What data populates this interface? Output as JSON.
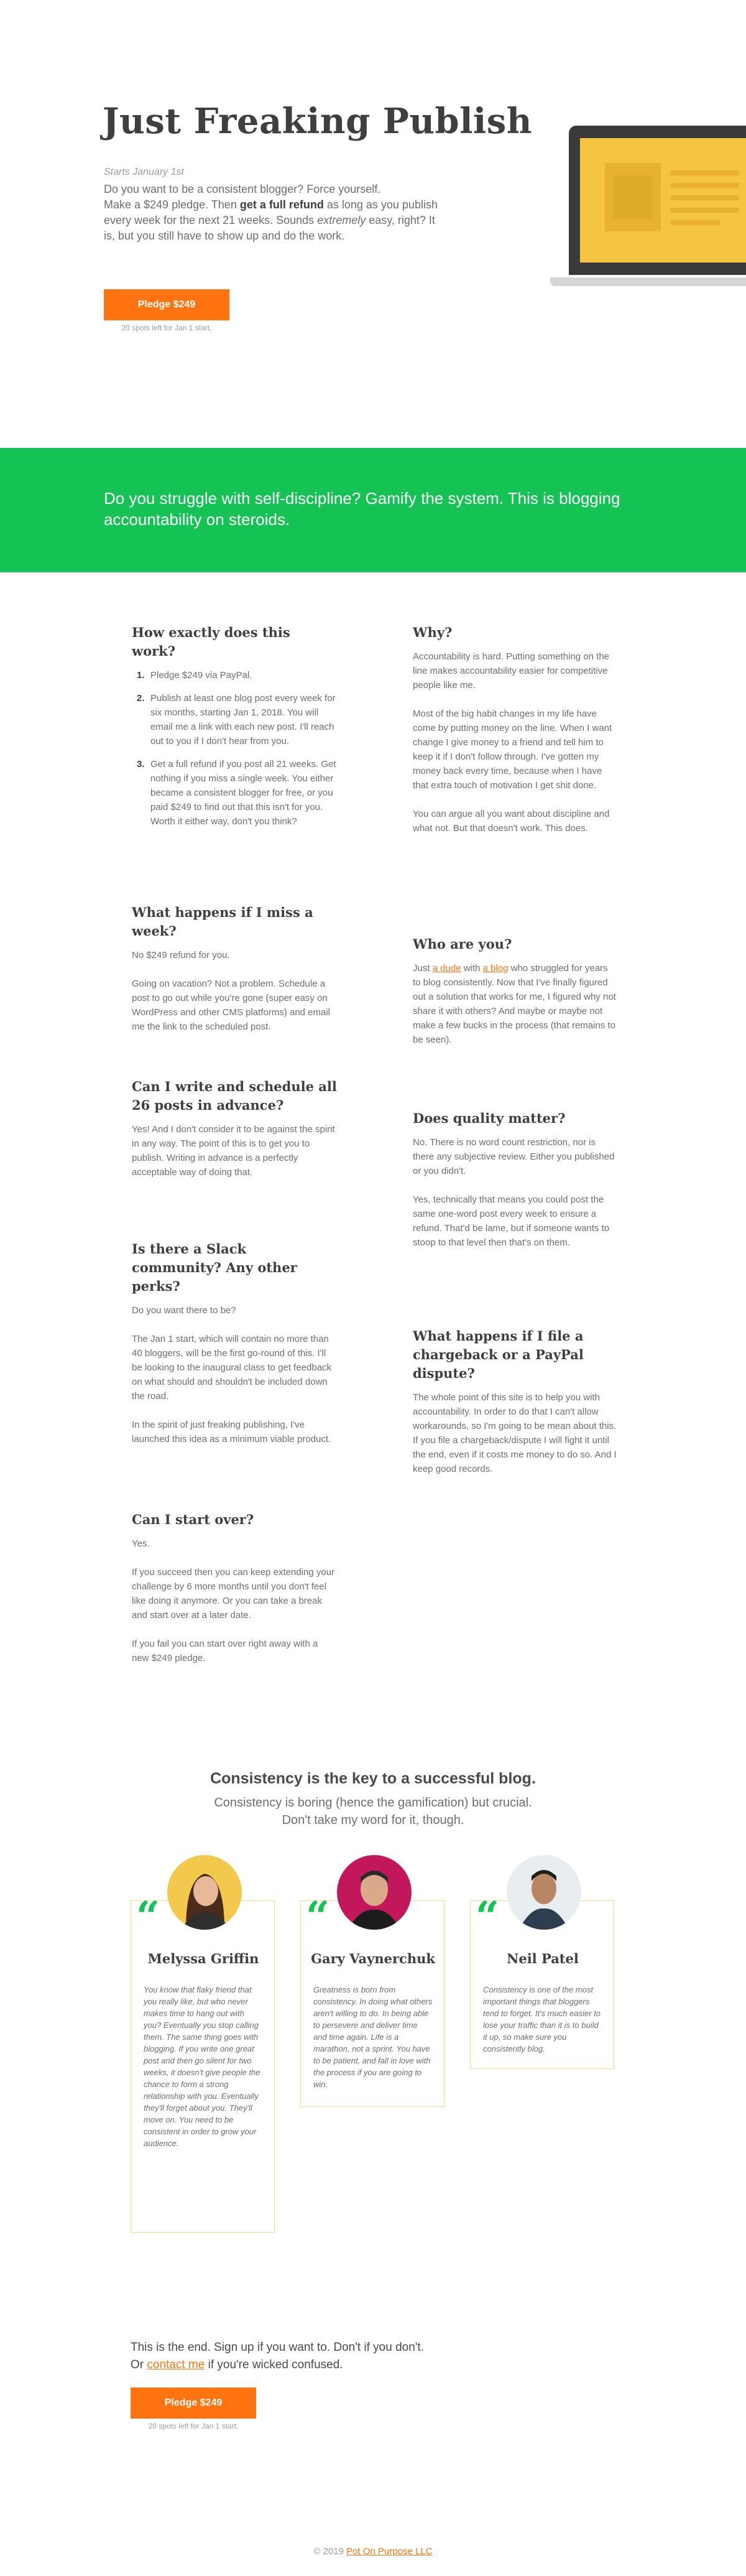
{
  "hero": {
    "title": "Just Freaking Publish",
    "starts": "Starts January 1st",
    "line1": "Do you want to be a consistent blogger? Force yourself.",
    "line2_pre": "Make a $249 pledge. Then ",
    "line2_bold": "get a full refund",
    "line2_post": " as long as you publish",
    "line3_pre": "every week for the next 21 weeks. Sounds ",
    "line3_italic": "extremely",
    "line3_post": " easy, right? It",
    "line4": "is, but you still have to show up and do the work.",
    "button_label": "Pledge $249",
    "spots": "20 spots left for Jan 1 start."
  },
  "band": {
    "text": "Do you struggle with self-discipline? Gamify the system. This is blogging accountability on steroids."
  },
  "faq": {
    "how": {
      "q": "How exactly does this work?",
      "items": [
        {
          "num": "1.",
          "text": "Pledge $249 via PayPal."
        },
        {
          "num": "2.",
          "text": "Publish at least one blog post every week for six months, starting Jan 1, 2018. You will email me a link with each new post. I'll reach out to you if I don't hear from you."
        },
        {
          "num": "3.",
          "text": "Get a full refund if you post all 21 weeks. Get nothing if you miss a single week. You either became a consistent blogger for free, or you paid $249 to find out that this isn't for you. Worth it either way, don't you think?"
        }
      ]
    },
    "why": {
      "q": "Why?",
      "p1": "Accountability is hard. Putting something on the line makes accountability easier for competitive people like me.",
      "p2": "Most of the big habit changes in my life have come by putting money on the line. When I want change I give money to a friend and tell him to keep it if I don't follow through. I've gotten my money back every time, because when I have that extra touch of motivation I get shit done.",
      "p3": "You can argue all you want about discipline and what not. But that doesn't work. This does."
    },
    "miss": {
      "q": "What happens if I miss a week?",
      "p1": "No $249 refund for you.",
      "p2": "Going on vacation? Not a problem. Schedule a post to go out while you're gone (super easy on WordPress and other CMS platforms) and email me the link to the scheduled post."
    },
    "who": {
      "q": "Who are you?",
      "pre": "Just ",
      "link1": "a dude",
      "mid": " with ",
      "link2": "a blog",
      "post": " who struggled for years to blog consistently. Now that I've finally figured out a solution that works for me, I figured why not share it with others? And maybe or maybe not make a few bucks in the process (that remains to be seen)."
    },
    "schedule": {
      "q": "Can I write and schedule all 26 posts in advance?",
      "p1": "Yes! And I don't consider it to be against the spirit in any way. The point of this is to get you to publish. Writing in advance is a perfectly acceptable way of doing that."
    },
    "quality": {
      "q": "Does quality matter?",
      "p1": "No. There is no word count restriction, nor is there any subjective review. Either you published or you didn't.",
      "p2": "Yes, technically that means you could post the same one-word post every week to ensure a refund. That'd be lame, but if someone wants to stoop to that level then that's on them."
    },
    "slack": {
      "q": "Is there a Slack community? Any other perks?",
      "p1": "Do you want there to be?",
      "p2": "The Jan 1 start, which will contain no more than 40 bloggers, will be the first go-round of this. I'll be looking to the inaugural class to get feedback on what should and shouldn't be included down the road.",
      "p3": "In the spirit of just freaking publishing, I've launched this idea as a minimum viable product."
    },
    "chargeback": {
      "q": "What happens if I file a chargeback or a PayPal dispute?",
      "p1": "The whole point of this site is to help you with accountability. In order to do that I can't allow workarounds, so I'm going to be mean about this. If you file a chargeback/dispute I will fight it until the end, even if it costs me money to do so. And I keep good records."
    },
    "over": {
      "q": "Can I start over?",
      "p1": "Yes.",
      "p2": "If you succeed then you can keep extending your challenge by 6 more months until you don't feel like doing it anymore. Or you can take a break and start over at a later date.",
      "p3": "If you fail you can start over right away with a new $249 pledge."
    }
  },
  "consistency": {
    "title": "Consistency is the key to a successful blog.",
    "sub1": "Consistency is boring (hence the gamification) but crucial.",
    "sub2": "Don't take my word for it, though."
  },
  "testimonials": [
    {
      "name": "Melyssa Griffin",
      "quote_icon": "quote-icon",
      "text": "You know that flaky friend that you really like, but who never makes time to hang out with you? Eventually you stop calling them. The same thing goes with blogging. If you write one great post and then go silent for two weeks, it doesn't give people the chance to form a strong relationship with you. Eventually they'll forget about you. They'll move on. You need to be consistent in order to grow your audience.",
      "avatar_bg": "#f2c94c"
    },
    {
      "name": "Gary Vaynerchuk",
      "quote_icon": "quote-icon",
      "text": "Greatness is born from consistency. In doing what others aren't willing to do. In being able to persevere and deliver time and time again. Life is a marathon, not a sprint. You have to be patient, and fall in love with the process if you are going to win.",
      "avatar_bg": "#c2185b"
    },
    {
      "name": "Neil Patel",
      "quote_icon": "quote-icon",
      "text": "Consistency is one of the most important things that bloggers tend to forget. It's much easier to lose your traffic than it is to build it up, so make sure you consistently blog.",
      "avatar_bg": "#e8eef0"
    }
  ],
  "end": {
    "line1": "This is the end. Sign up if you want to. Don't if you don't.",
    "line2_pre": "Or ",
    "line2_link": "contact me",
    "line2_post": " if you're wicked confused.",
    "button_label": "Pledge $249",
    "spots": "20 spots left for Jan 1 start."
  },
  "footer": {
    "pre": "© 2019 ",
    "link": "Pot On Purpose LLC"
  },
  "colors": {
    "accent": "#ff7410",
    "green": "#15c355",
    "text": "#6e6e6e",
    "heading": "#3f3f3f"
  }
}
